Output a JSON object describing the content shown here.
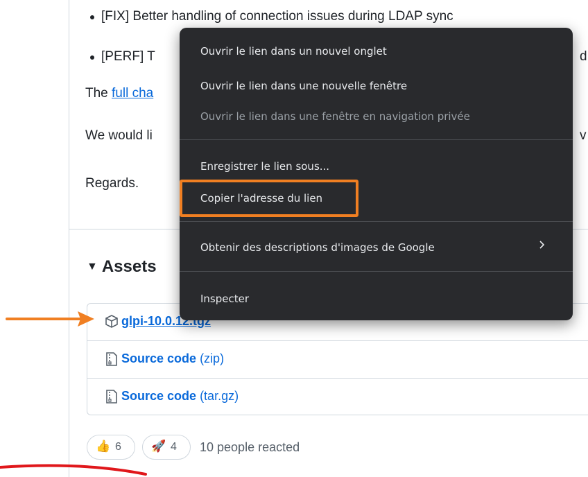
{
  "release_notes": {
    "bullets": [
      "[FIX] Better handling of connection issues during LDAP sync",
      "[PERF] T"
    ],
    "bullet2_tail": "d t",
    "changelog_prefix": "The ",
    "changelog_link": "full cha",
    "would_like": "We would li",
    "would_like_tail": "v",
    "regards": "Regards."
  },
  "assets": {
    "heading": "Assets",
    "items": [
      {
        "name": "glpi-10.0.12.tgz",
        "ext": ""
      },
      {
        "name": "Source code",
        "ext": "(zip)"
      },
      {
        "name": "Source code",
        "ext": "(tar.gz)"
      }
    ]
  },
  "reactions": {
    "items": [
      {
        "emoji": "👍",
        "count": "6"
      },
      {
        "emoji": "🚀",
        "count": "4"
      }
    ],
    "summary": "10 people reacted"
  },
  "context_menu": {
    "items": [
      {
        "label": "Ouvrir le lien dans un nouvel onglet",
        "enabled": true
      },
      {
        "label": "Ouvrir le lien dans une nouvelle fenêtre",
        "enabled": true
      },
      {
        "label": "Ouvrir le lien dans une fenêtre en navigation privée",
        "enabled": false
      },
      {
        "label": "Enregistrer le lien sous...",
        "enabled": true
      },
      {
        "label": "Copier l'adresse du lien",
        "enabled": true,
        "highlighted": true
      },
      {
        "label": "Obtenir des descriptions d'images de Google",
        "enabled": true,
        "has_submenu": true
      },
      {
        "label": "Inspecter",
        "enabled": true
      }
    ]
  },
  "colors": {
    "annotation_arrow": "#f07f22",
    "annotation_highlight": "#f07f22",
    "annotation_curve": "#e0171b",
    "link": "#0969da",
    "menu_bg": "#292a2d"
  }
}
